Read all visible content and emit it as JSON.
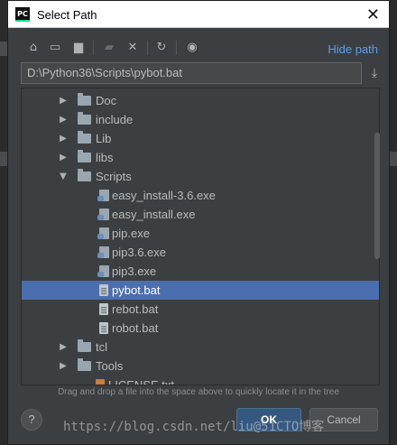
{
  "dialog": {
    "title": "Select Path",
    "app_icon_text": "PC",
    "close_glyph": "✕"
  },
  "toolbar": {
    "hide_path_label": "Hide path",
    "icons": [
      "home-icon",
      "desktop-icon",
      "project-folder-icon",
      "new-folder-icon",
      "delete-icon",
      "refresh-icon",
      "show-hidden-icon"
    ]
  },
  "path": {
    "value": "D:\\Python36\\Scripts\\pybot.bat"
  },
  "tree": {
    "items": [
      {
        "label": "Doc",
        "type": "folder",
        "expanded": false
      },
      {
        "label": "include",
        "type": "folder",
        "expanded": false
      },
      {
        "label": "Lib",
        "type": "folder",
        "expanded": false
      },
      {
        "label": "libs",
        "type": "folder",
        "expanded": false
      },
      {
        "label": "Scripts",
        "type": "folder",
        "expanded": true
      },
      {
        "label": "easy_install-3.6.exe",
        "type": "exe"
      },
      {
        "label": "easy_install.exe",
        "type": "exe"
      },
      {
        "label": "pip.exe",
        "type": "exe"
      },
      {
        "label": "pip3.6.exe",
        "type": "exe"
      },
      {
        "label": "pip3.exe",
        "type": "exe"
      },
      {
        "label": "pybot.bat",
        "type": "file",
        "selected": true
      },
      {
        "label": "rebot.bat",
        "type": "file"
      },
      {
        "label": "robot.bat",
        "type": "file"
      },
      {
        "label": "tcl",
        "type": "folder",
        "expanded": false
      },
      {
        "label": "Tools",
        "type": "folder",
        "expanded": false
      },
      {
        "label": "LICENSE.txt",
        "type": "license"
      }
    ]
  },
  "hint": "Drag and drop a file into the space above to quickly locate it in the tree",
  "buttons": {
    "help": "?",
    "ok": "OK",
    "cancel": "Cancel"
  },
  "watermark": "https://blog.csdn.net/liu@51CTO博客",
  "colors": {
    "background": "#3c3f41",
    "selection": "#4b6eaf",
    "link": "#589df6",
    "ok_button": "#365880"
  }
}
